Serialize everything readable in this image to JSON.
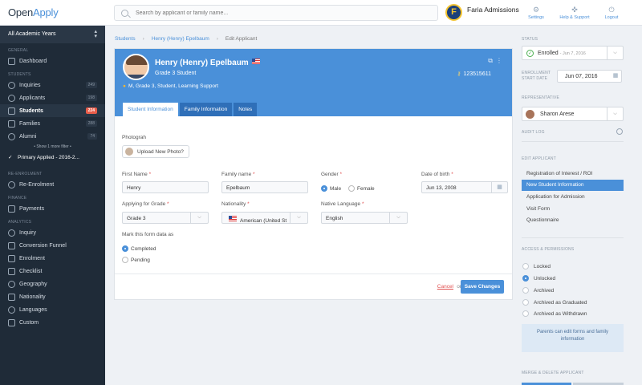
{
  "app": {
    "logo_part1": "Open",
    "logo_part2": "Apply",
    "school_initial": "F",
    "school_name": "Faria Admissions"
  },
  "search": {
    "placeholder": "Search by applicant or family name..."
  },
  "top_actions": [
    {
      "label": "Settings",
      "icon": "gear-icon"
    },
    {
      "label": "Help & Support",
      "icon": "lifebuoy-icon"
    },
    {
      "label": "Logout",
      "icon": "power-icon"
    }
  ],
  "sidebar": {
    "year_selector": "All Academic Years",
    "section_general": "General",
    "dashboard": "Dashboard",
    "section_students": "Students",
    "inquiries": "Inquiries",
    "inquiries_count": "249",
    "applicants": "Applicants",
    "applicants_count": "198",
    "students": "Students",
    "students_count": "224",
    "families": "Families",
    "families_count": "288",
    "alumni": "Alumni",
    "alumni_count": "74",
    "show_more": "• Show 1 more filter •",
    "primary_applied": "Primary Applied - 2016-2...",
    "section_reenrolment": "Re-Enrolment",
    "reenrolment": "Re-Enrolment",
    "section_finance": "Finance",
    "payments": "Payments",
    "section_analytics": "Analytics",
    "analytics": [
      "Inquiry",
      "Conversion Funnel",
      "Enrolment",
      "Checklist",
      "Geography",
      "Nationality",
      "Languages",
      "Custom"
    ]
  },
  "breadcrumb": {
    "students": "Students",
    "student": "Henry (Henry) Epelbaum",
    "current": "Edit Applicant"
  },
  "student": {
    "name": "Henry (Henry) Epelbaum",
    "grade_label": "Grade 3 Student",
    "tags": "M, Grade 3, Student,  Learning Support",
    "id": "123515611"
  },
  "tabs": [
    "Student Information",
    "Family Information",
    "Notes"
  ],
  "form": {
    "photograph_label": "Photograh",
    "upload_button": "Upload New Photo?",
    "first_name_label": "First Name",
    "first_name_value": "Henry",
    "family_name_label": "Family name",
    "family_name_value": "Epelbaum",
    "gender_label": "Gender",
    "gender_male": "Male",
    "gender_female": "Female",
    "dob_label": "Date of birth",
    "dob_value": "Jun 13, 2008",
    "grade_label": "Applying for Grade",
    "grade_value": "Grade 3",
    "nationality_label": "Nationality",
    "nationality_value": "American (United St",
    "language_label": "Native Language",
    "language_value": "English",
    "mark_label": "Mark this form data as",
    "completed": "Completed",
    "pending": "Pending",
    "required_mark": "*",
    "cancel": "Cancel",
    "or": "or",
    "save": "Save Changes"
  },
  "right": {
    "status_label": "Status",
    "status_value": "Enrolled",
    "status_date": "- Jun 7, 2016",
    "enrollment_label_1": "Enrollment",
    "enrollment_label_2": "Start Date",
    "enrollment_date": "Jun 07, 2016",
    "rep_label": "Representative",
    "rep_value": "Sharon Arese",
    "audit_label": "Audit Log",
    "edit_label": "Edit Applicant",
    "forms": [
      "Registration of Interest / ROI",
      "New Student Information",
      "Application for Admission",
      "Visit Form",
      "Questionnaire"
    ],
    "access_label": "Access & Permissions",
    "access": [
      "Locked",
      "Unlocked",
      "Archived",
      "Archived as Graduated",
      "Archived as Withdrawn"
    ],
    "info": "Parents can edit forms and family information",
    "merge_label": "Merge & Delete Applicant"
  }
}
